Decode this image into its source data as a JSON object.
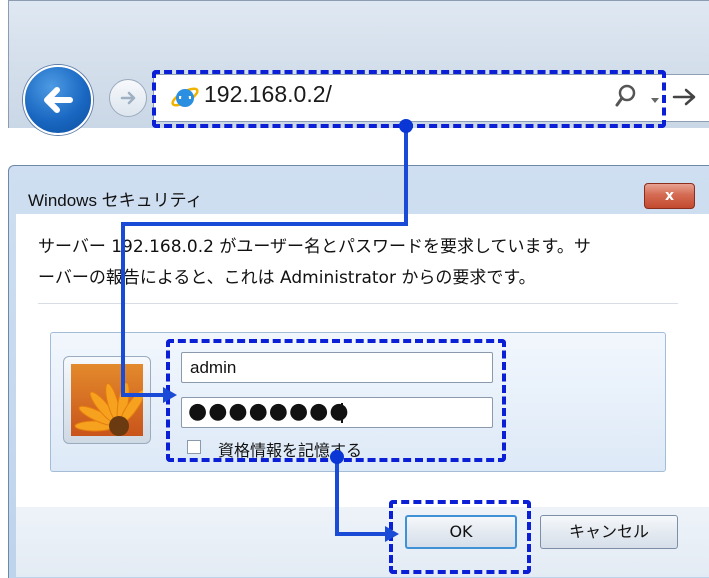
{
  "browser": {
    "url": "192.168.0.2/",
    "icons": [
      "back-arrow-icon",
      "forward-arrow-icon",
      "ie-icon",
      "search-icon",
      "dropdown-icon",
      "go-arrow-icon"
    ]
  },
  "dialog": {
    "title": "Windows セキュリティ",
    "close_label": "x",
    "message_line1": "サーバー 192.168.0.2 がユーザー名とパスワードを要求しています。サ",
    "message_line2": "ーバーの報告によると、これは Administrator からの要求です。",
    "username_value": "admin",
    "password_mask": "●●●●●●●●",
    "remember_label": "資格情報を記憶する",
    "ok_label": "OK",
    "cancel_label": "キャンセル"
  },
  "annotation": {
    "highlight_color": "#0a1fd6",
    "arrow_color": "#1a4bd6"
  }
}
